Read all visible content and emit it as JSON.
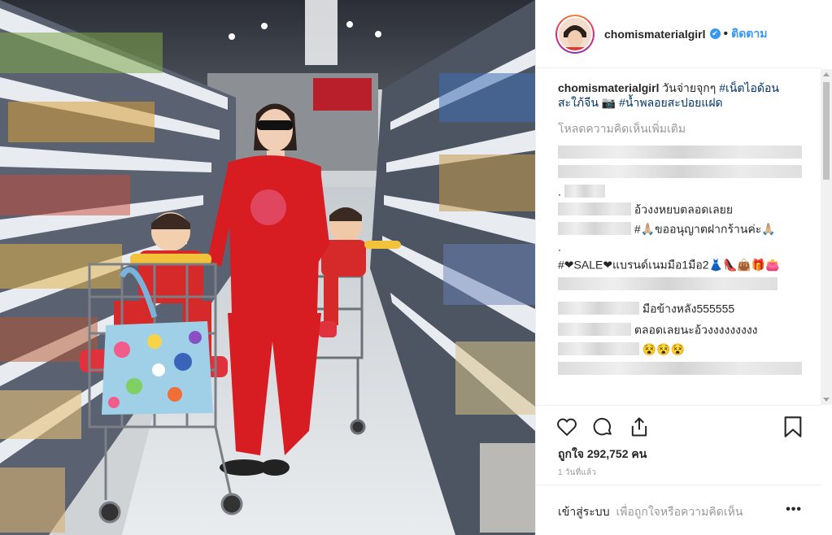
{
  "post": {
    "username": "chomismaterialgirl",
    "follow_label": "ติดตาม",
    "dot": "•",
    "verified_icon": "✔"
  },
  "caption": {
    "username": "chomismaterialgirl",
    "text_1": "วันจ่ายจุกๆ",
    "hashtag_1": "#เน็ตไอด้อนสะใภ้จีน",
    "camera": "📷",
    "hashtag_2": "#น้ำพลอยสะปอยแฝด"
  },
  "load_more": "โหลดความคิดเห็นเพิ่มเติม",
  "comments": [
    {
      "text": ""
    },
    {
      "text": "."
    },
    {
      "text": "อ้วงงหยบตลอดเลยย"
    },
    {
      "text": "#🙏🏼ขออนุญาตฝากร้านค่ะ🙏🏼"
    },
    {
      "text": "."
    },
    {
      "text": "#❤SALE❤แบรนด์เนมมือ1มือ2👗👠👜🎁👛"
    },
    {
      "text": ""
    },
    {
      "text": "มือข้างหลัง555555"
    },
    {
      "text": "ตลอดเลยนะอ้วงงงงงงงงง"
    },
    {
      "text": "😵😵😵"
    }
  ],
  "actions": {
    "like_icon": "heart-icon",
    "comment_icon": "comment-icon",
    "share_icon": "share-icon",
    "save_icon": "bookmark-icon"
  },
  "likes": "ถูกใจ 292,752 คน",
  "timestamp": "1 วันที่แล้ว",
  "login": {
    "link": "เข้าสู่ระบบ",
    "rest": "เพื่อถูกใจหรือความคิดเห็น",
    "more": "•••"
  },
  "colors": {
    "link_blue": "#3897f0",
    "hashtag": "#003569",
    "muted": "#999999",
    "border": "#efefef"
  }
}
